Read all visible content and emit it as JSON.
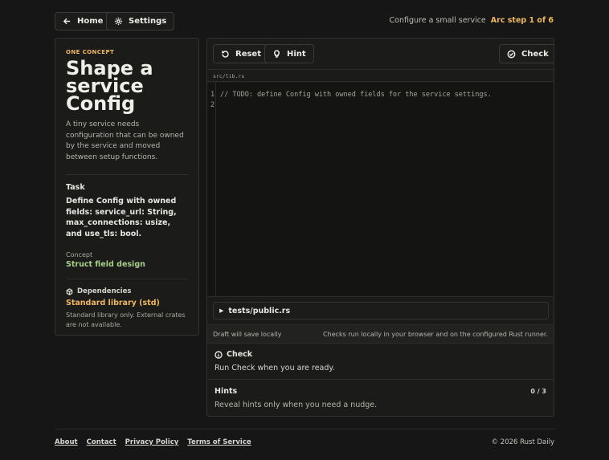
{
  "nav": {
    "home_label": "Home",
    "settings_label": "Settings"
  },
  "header": {
    "status_text": "Configure a small service",
    "step_text": "Arc step 1 of 6"
  },
  "lesson": {
    "eyebrow": "ONE CONCEPT",
    "title": "Shape a service Config",
    "description": "A tiny service needs configuration that can be owned by the service and moved between setup functions.",
    "task_label": "Task",
    "task_text": "Define Config with owned fields: service_url: String, max_connections: usize, and use_tls: bool.",
    "concept_label": "Concept",
    "concept_value": "Struct field design",
    "dependencies_label": "Dependencies",
    "dependencies_value": "Standard library (std)",
    "dependencies_note": "Standard library only. External crates are not available."
  },
  "toolbar": {
    "reset_label": "Reset",
    "hint_label": "Hint",
    "check_label": "Check"
  },
  "editor": {
    "file_name": "src/lib.rs",
    "lines": [
      "// TODO: define Config with owned fields for the service settings.",
      ""
    ],
    "line_numbers": [
      "1",
      "2"
    ]
  },
  "tests": {
    "label": "tests/public.rs"
  },
  "status": {
    "draft_text": "Draft will save locally",
    "runner_text": "Checks run locally in your browser and on the configured Rust runner."
  },
  "check": {
    "title": "Check",
    "message": "Run Check when you are ready."
  },
  "hints": {
    "title": "Hints",
    "count": "0 / 3",
    "message": "Reveal hints only when you need a nudge."
  },
  "footer": {
    "links": [
      "About",
      "Contact",
      "Privacy Policy",
      "Terms of Service"
    ],
    "copyright": "© 2026 Rust Daily"
  },
  "colors": {
    "accent": "#f0b860",
    "concept": "#a8cf8a",
    "background": "#161616"
  }
}
